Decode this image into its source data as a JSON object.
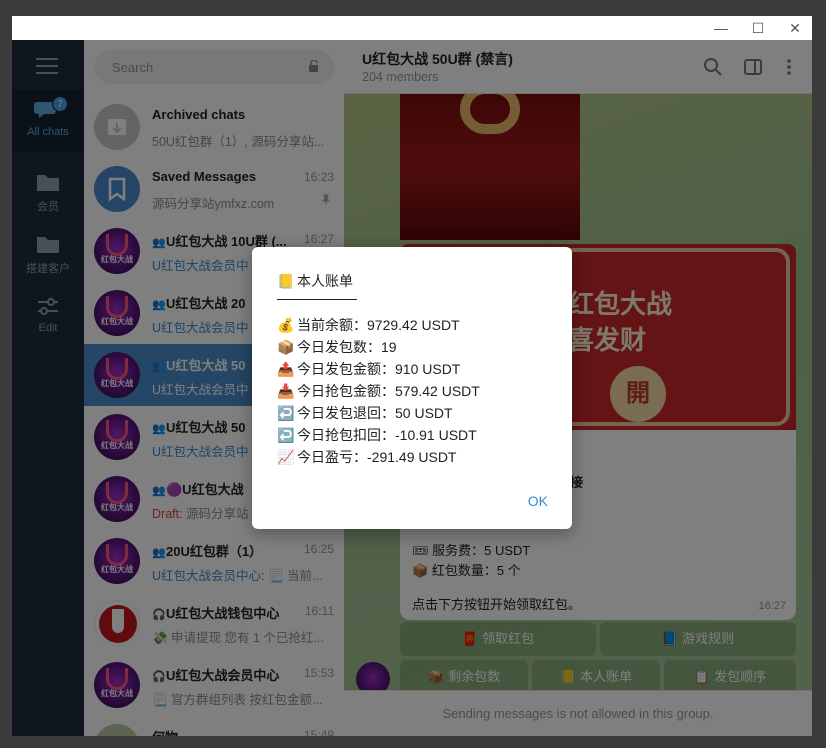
{
  "window": {
    "minimize_glyph": "—",
    "maximize_glyph": "☐",
    "close_glyph": "✕"
  },
  "rail": {
    "items": [
      {
        "label": "All chats",
        "badge": "7",
        "icon": "chats-icon"
      },
      {
        "label": "会员",
        "icon": "folder-icon"
      },
      {
        "label": "搭建客户",
        "icon": "folder-icon"
      },
      {
        "label": "Edit",
        "icon": "sliders-icon"
      }
    ]
  },
  "search": {
    "placeholder": "Search"
  },
  "chats": [
    {
      "name": "Archived chats",
      "time": "",
      "preview": "50U红包群（1）, 源码分享站...",
      "avatar": "archive-icon"
    },
    {
      "name": "Saved Messages",
      "time": "16:23",
      "preview": "源码分享站ymfxz.com",
      "avatar": "bookmark-icon"
    },
    {
      "name": "U红包大战 10U群 (...",
      "time": "16:27",
      "preview_hl": "U红包大战会员中",
      "preview": ""
    },
    {
      "name": "U红包大战 20",
      "time": "",
      "preview_hl": "U红包大战会员中",
      "preview": ""
    },
    {
      "name": "U红包大战 50",
      "time": "",
      "preview_hl": "U红包大战会员中",
      "preview": ""
    },
    {
      "name": "U红包大战 50",
      "time": "",
      "preview_hl": "U红包大战会员中",
      "preview": ""
    },
    {
      "name": "🟣U红包大战",
      "time": "",
      "preview_draft": "Draft:",
      "preview": "源码分享站"
    },
    {
      "name": "20U红包群（1）",
      "time": "16:25",
      "preview_hl": "U红包大战会员中心:",
      "preview": "📃 当前..."
    },
    {
      "name": "U红包大战钱包中心",
      "time": "16:11",
      "preview": "💸 申请提现 您有 1 个已抢红..."
    },
    {
      "name": "U红包大战会员中心",
      "time": "15:53",
      "preview": "📃 官方群组列表 按红包金额..."
    },
    {
      "name": "何物",
      "time": "15:49",
      "preview": ""
    }
  ],
  "header": {
    "title": "U红包大战 50U群 (禁言)",
    "subtitle": "204 members"
  },
  "message": {
    "banner_line1": "红包大战",
    "banner_line2": "喜发财",
    "seal": "開",
    "line_partial": "接",
    "fee": "服务费：5 USDT",
    "count": "红包数量：5 个",
    "instruction": "点击下方按钮开始领取红包。",
    "time": "16:27"
  },
  "keyboard": {
    "row1": [
      {
        "emoji": "🧧",
        "label": "领取红包"
      },
      {
        "emoji": "📘",
        "label": "游戏规则"
      }
    ],
    "row2": [
      {
        "emoji": "📦",
        "label": "剩余包数"
      },
      {
        "emoji": "📒",
        "label": "本人账单"
      },
      {
        "emoji": "📋",
        "label": "发包顺序"
      }
    ]
  },
  "footer": {
    "text": "Sending messages is not allowed in this group."
  },
  "dialog": {
    "title_emoji": "📒",
    "title": "本人账单",
    "lines": [
      {
        "emoji": "💰",
        "text": "当前余额：9729.42 USDT"
      },
      {
        "emoji": "📦",
        "text": "今日发包数：19"
      },
      {
        "emoji": "📤",
        "text": "今日发包金额：910 USDT"
      },
      {
        "emoji": "📥",
        "text": "今日抢包金额：579.42 USDT"
      },
      {
        "emoji": "↩️",
        "text": "今日发包退回：50 USDT"
      },
      {
        "emoji": "↩️",
        "text": "今日抢包扣回：-10.91 USDT"
      },
      {
        "emoji": "📈",
        "text": "今日盈亏：-291.49 USDT"
      }
    ],
    "ok": "OK"
  },
  "colors": {
    "accent": "#3a8ad3",
    "rail_bg": "#1f2c3a",
    "selected_row": "#4a8cc9",
    "draft": "#d2483b"
  }
}
